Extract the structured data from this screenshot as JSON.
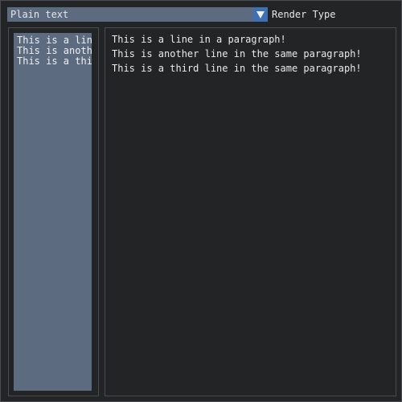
{
  "render_combo": {
    "selected": "Plain text",
    "label": "Render Type",
    "arrow_icon": "triangle-down-icon"
  },
  "paragraph": {
    "lines": [
      "This is a line in a paragraph!",
      "This is another line in the same paragraph!",
      "This is a third line in the same paragraph!"
    ]
  },
  "colors": {
    "window_bg": "#232426",
    "frame_bg": "#5d6b80",
    "arrow_button": "#3e71b3",
    "border": "#4b4c4f"
  }
}
